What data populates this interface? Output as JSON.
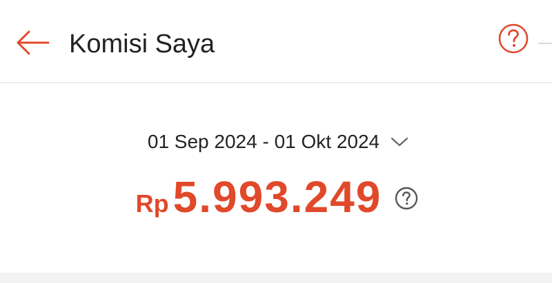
{
  "header": {
    "title": "Komisi Saya",
    "back_icon": "arrow-left-icon",
    "help_icon": "question-circle-icon"
  },
  "summary": {
    "date_range": "01 Sep 2024 - 01 Okt 2024",
    "dropdown_icon": "chevron-down-icon",
    "currency": "Rp",
    "amount": "5.993.249",
    "info_icon": "question-circle-icon"
  },
  "colors": {
    "accent": "#e0492a",
    "text": "#222222",
    "muted": "#555555",
    "divider": "#eeeeee"
  }
}
